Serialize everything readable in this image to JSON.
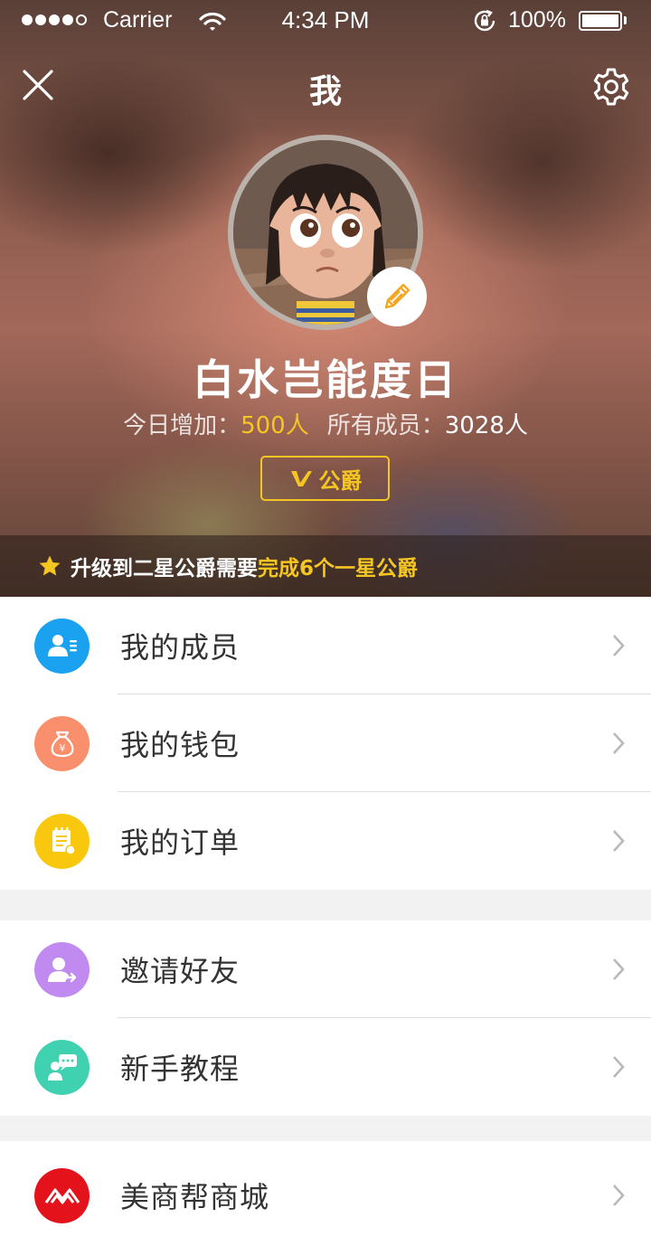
{
  "status_bar": {
    "carrier": "Carrier",
    "time": "4:34 PM",
    "battery": "100%"
  },
  "nav": {
    "title": "我",
    "close_icon": "close-icon",
    "settings_icon": "gear-icon"
  },
  "profile": {
    "name": "白水岂能度日",
    "today_label": "今日增加：",
    "today_value": "500人",
    "total_label": "所有成员：",
    "total_value": "3028人",
    "rank_label": "公爵",
    "edit_icon": "pencil-icon"
  },
  "tip": {
    "prefix": "升级到二星公爵需要",
    "highlight": "完成6个一星公爵"
  },
  "menu_groups": [
    {
      "items": [
        {
          "label": "我的成员",
          "icon": "members-icon",
          "color": "#1aa1f0"
        },
        {
          "label": "我的钱包",
          "icon": "money-bag-icon",
          "color": "#f98f6c"
        },
        {
          "label": "我的订单",
          "icon": "order-icon",
          "color": "#f9c70d"
        }
      ]
    },
    {
      "items": [
        {
          "label": "邀请好友",
          "icon": "invite-friend-icon",
          "color": "#c18af1"
        },
        {
          "label": "新手教程",
          "icon": "tutorial-icon",
          "color": "#3fd1b0"
        }
      ]
    },
    {
      "items": [
        {
          "label": "美商帮商城",
          "icon": "mall-logo-icon",
          "color": "#e4121b"
        }
      ]
    }
  ],
  "colors": {
    "accent_yellow": "#f5c621",
    "page_background": "#f2f2f2"
  }
}
